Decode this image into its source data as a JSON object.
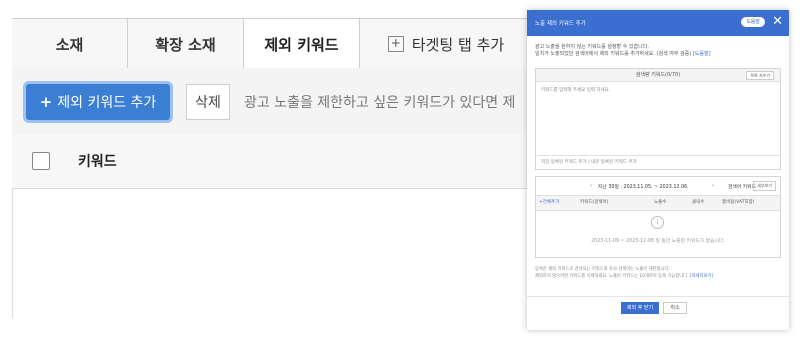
{
  "tabs": {
    "creative": "소재",
    "extension": "확장 소재",
    "negative_keywords": "제외 키워드",
    "targeting": "타겟팅 탭 추가"
  },
  "toolbar": {
    "add_label": "제외 키워드 추가",
    "delete_label": "삭제",
    "hint": "광고 노출을 제한하고 싶은 키워드가 있다면 제"
  },
  "table": {
    "header_keyword": "키워드"
  },
  "modal": {
    "title": "노출 제외 키워드 추가",
    "help_label": "도움말",
    "close_symbol": "✕",
    "desc_line1": "광고 노출을 원하지 않는 키워드를 설정할 수 있습니다.",
    "desc_line2": "일치가 노출되었던 검색어에서 제외 키워드를 추가하세요. (검색 여부 검증)",
    "desc_link": "[도움말]",
    "input_box": {
      "header": "검색량 키워드(0/70)",
      "reset_label": "목록 지우기",
      "placeholder": "키워드를 입력해 주세요 입력 하세요.",
      "footer": "저장 등록된 키워드 추가 / 내문 등록된 키워드 추가"
    },
    "report": {
      "period": "지난 30일 : 2023.11.05. ~ 2023.12.06.",
      "segment": "검색어 키워드",
      "option_label": "세부보기",
      "columns": [
        "+전체추가",
        "키워드(검색어)",
        "노출수",
        "클릭수",
        "총비용(VAT포함)"
      ],
      "empty_icon": "i",
      "empty_text": "2023-11-09 ~ 2023-12-08 일 동안 노출된 키워드가 없습니다."
    },
    "notes": [
      "등록한 제외 키워드로 검색되는 키워드와 유사 검색어는 노출이 제한됩니다.",
      "제외하지 않으려면 키워드를 삭제하세요. 노출된 키워드는 10개까지 등록 가능합니다."
    ],
    "notes_link": "[자세히보기]",
    "ok_label": "제외 후 닫기",
    "cancel_label": "취소"
  }
}
